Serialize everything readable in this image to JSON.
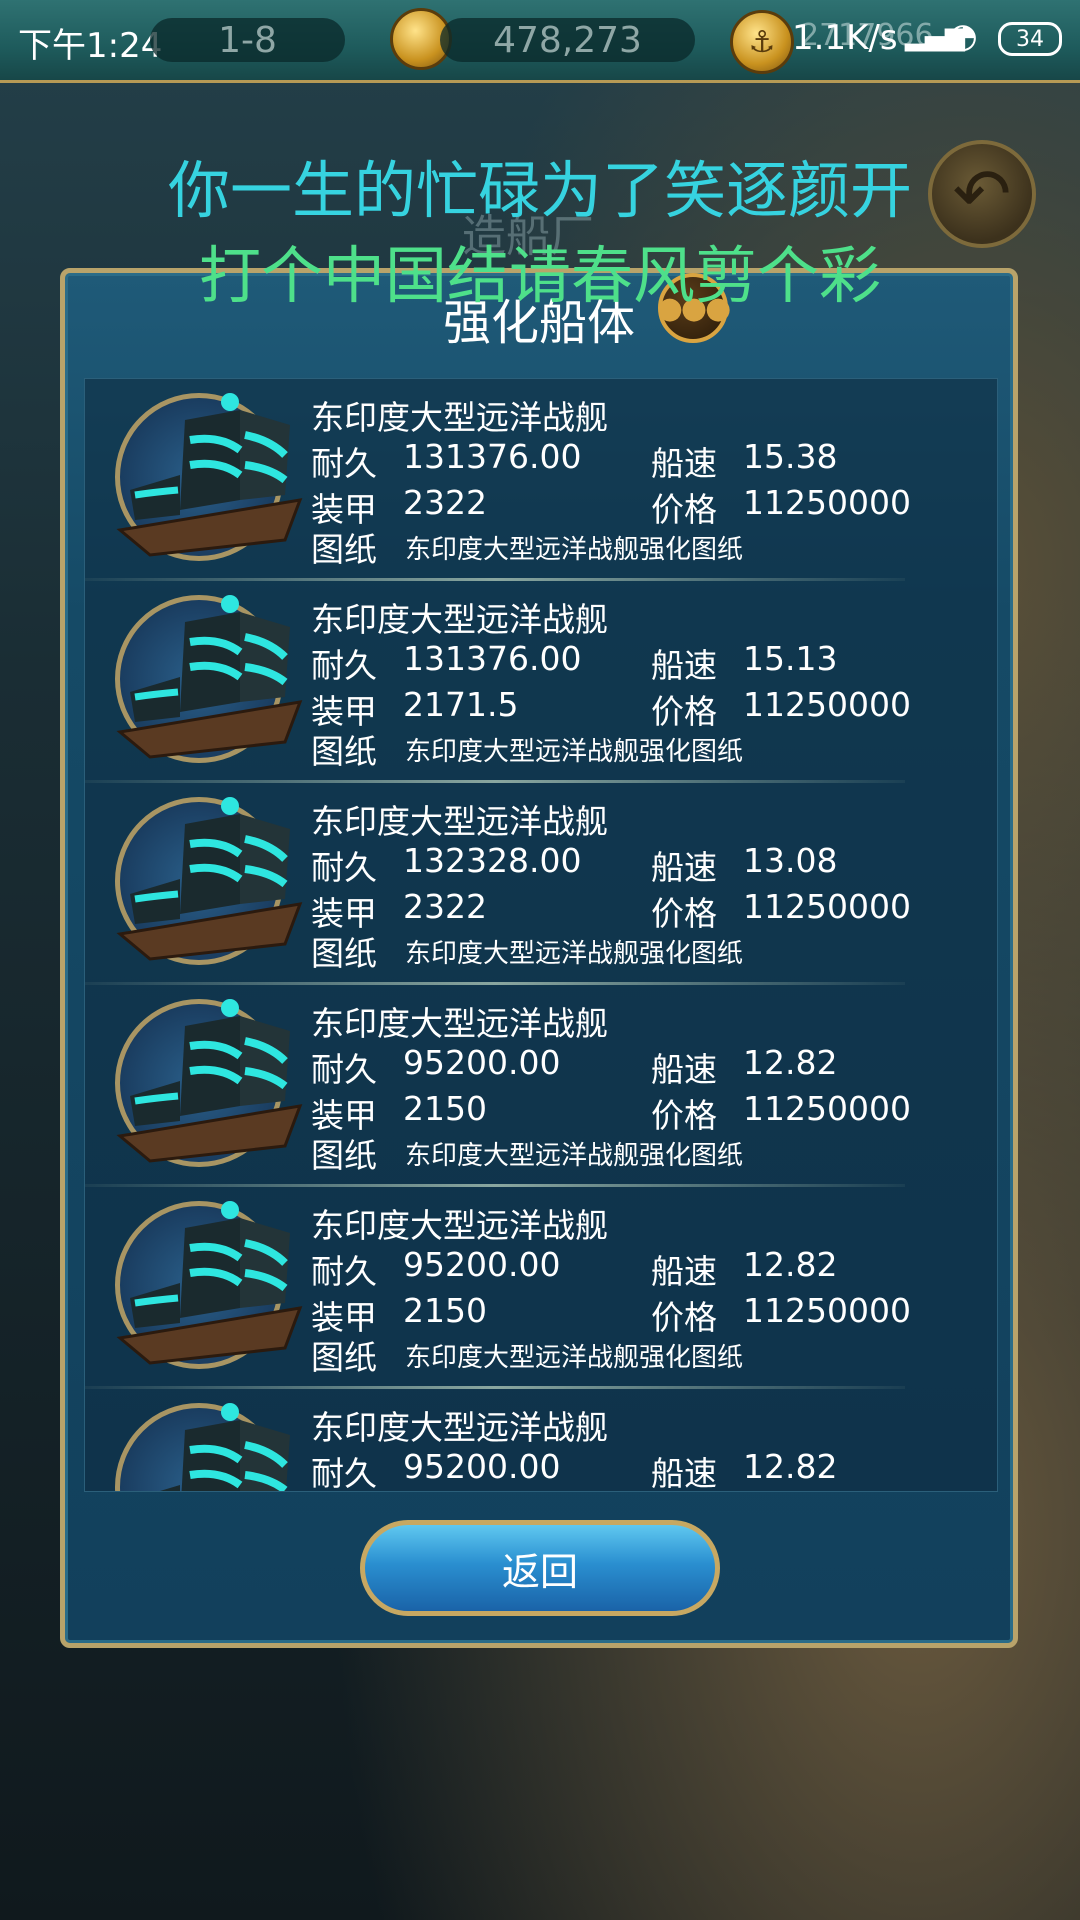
{
  "status": {
    "time": "下午1:24",
    "network_speed": "1.1K/s",
    "battery": "34"
  },
  "topbar": {
    "level": "1-8",
    "currency": "478,273",
    "secondary_currency": "2717966"
  },
  "overlay": {
    "lyric_line1": "你一生的忙碌为了笑逐颜开",
    "lyric_line2": "打个中国结请春风剪个彩",
    "background_label": "造船厂"
  },
  "panel": {
    "title": "强化船体",
    "labels": {
      "durability": "耐久",
      "speed": "船速",
      "armor": "装甲",
      "price": "价格",
      "blueprint": "图纸"
    },
    "ships": [
      {
        "name": "东印度大型远洋战舰",
        "durability": "131376.00",
        "speed": "15.38",
        "armor": "2322",
        "price": "11250000",
        "blueprint": "东印度大型远洋战舰强化图纸"
      },
      {
        "name": "东印度大型远洋战舰",
        "durability": "131376.00",
        "speed": "15.13",
        "armor": "2171.5",
        "price": "11250000",
        "blueprint": "东印度大型远洋战舰强化图纸"
      },
      {
        "name": "东印度大型远洋战舰",
        "durability": "132328.00",
        "speed": "13.08",
        "armor": "2322",
        "price": "11250000",
        "blueprint": "东印度大型远洋战舰强化图纸"
      },
      {
        "name": "东印度大型远洋战舰",
        "durability": "95200.00",
        "speed": "12.82",
        "armor": "2150",
        "price": "11250000",
        "blueprint": "东印度大型远洋战舰强化图纸"
      },
      {
        "name": "东印度大型远洋战舰",
        "durability": "95200.00",
        "speed": "12.82",
        "armor": "2150",
        "price": "11250000",
        "blueprint": "东印度大型远洋战舰强化图纸"
      },
      {
        "name": "东印度大型远洋战舰",
        "durability": "95200.00",
        "speed": "12.82"
      }
    ],
    "return_label": "返回"
  },
  "icons": [
    "compass-icon",
    "anchor-coin-icon",
    "signal-icon",
    "wifi-icon",
    "battery-icon",
    "back-arrow-icon",
    "chat-bubble-icon",
    "ship-icon"
  ]
}
